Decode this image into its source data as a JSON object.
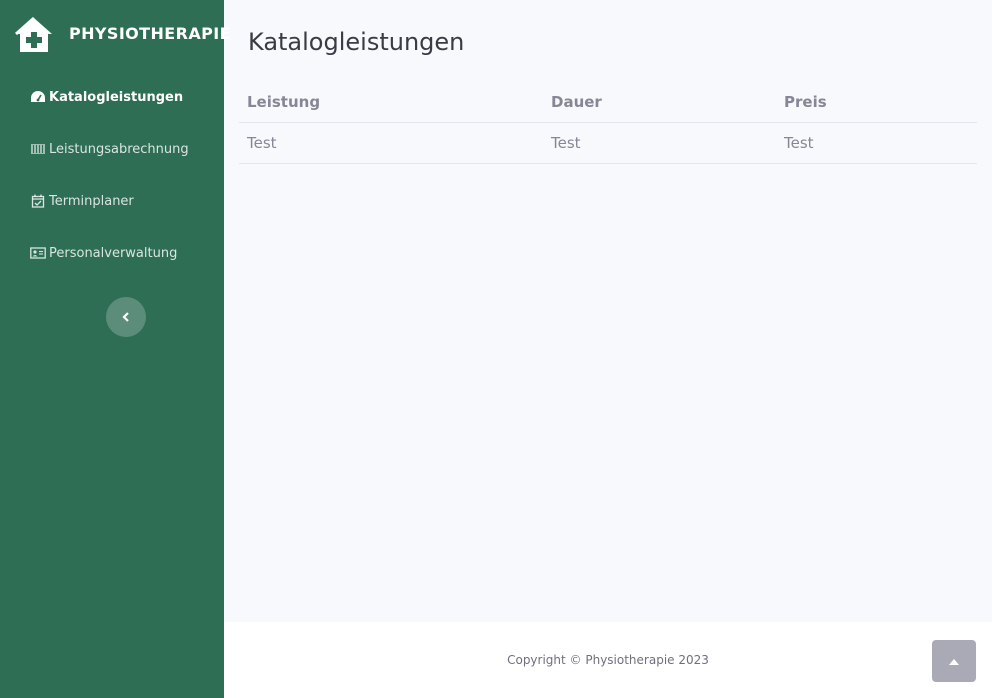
{
  "brand": {
    "name": "PHYSIOTHERAPIE",
    "icon": "clinic-house-icon"
  },
  "sidebar": {
    "items": [
      {
        "label": "Katalogleistungen",
        "icon": "tachometer-icon",
        "active": true
      },
      {
        "label": "Leistungsabrechnung",
        "icon": "barcode-icon",
        "active": false
      },
      {
        "label": "Terminplaner",
        "icon": "calendar-check-icon",
        "active": false
      },
      {
        "label": "Personalverwaltung",
        "icon": "id-card-icon",
        "active": false
      }
    ],
    "toggle_icon": "chevron-left-icon"
  },
  "main": {
    "title": "Katalogleistungen",
    "table": {
      "headers": [
        "Leistung",
        "Dauer",
        "Preis"
      ],
      "rows": [
        [
          "Test",
          "Test",
          "Test"
        ]
      ]
    }
  },
  "footer": {
    "copyright": "Copyright © Physiotherapie 2023"
  },
  "scroll_top_icon": "chevron-up-icon",
  "colors": {
    "sidebar": "#2e6e55",
    "background": "#f8f9fc",
    "text_muted": "#858796"
  }
}
